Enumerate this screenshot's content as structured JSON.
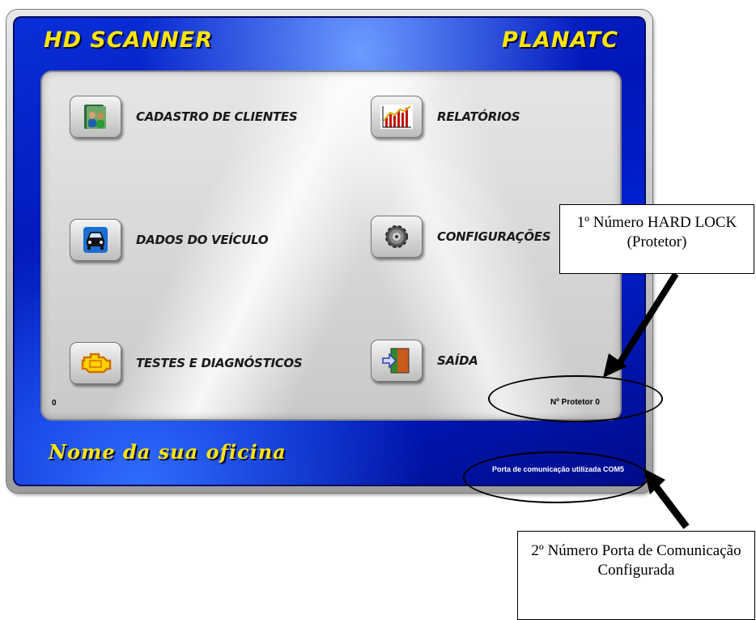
{
  "app": {
    "title_left": "HD SCANNER",
    "title_right": "PLANATC",
    "workshop_name": "Nome da sua oficina",
    "port_status": "Porta de comunicação utilizada COM5",
    "protector_status": "Nº Protetor 0",
    "corner_value": "0"
  },
  "menu": {
    "items": [
      {
        "label": "CADASTRO DE CLIENTES",
        "icon": "customers-icon"
      },
      {
        "label": "RELATÓRIOS",
        "icon": "report-chart-icon"
      },
      {
        "label": "DADOS DO VEÍCULO",
        "icon": "car-icon"
      },
      {
        "label": "CONFIGURAÇÕES",
        "icon": "settings-gear-icon"
      },
      {
        "label": "TESTES E DIAGNÓSTICOS",
        "icon": "engine-icon"
      },
      {
        "label": "SAÍDA",
        "icon": "exit-door-icon"
      }
    ]
  },
  "annotations": {
    "callout_1": "1º Número HARD LOCK (Protetor)",
    "callout_2": "2º Número Porta de Comunicação Configurada"
  },
  "colors": {
    "title_yellow": "#ffe600",
    "frame_blue": "#0016b8"
  }
}
